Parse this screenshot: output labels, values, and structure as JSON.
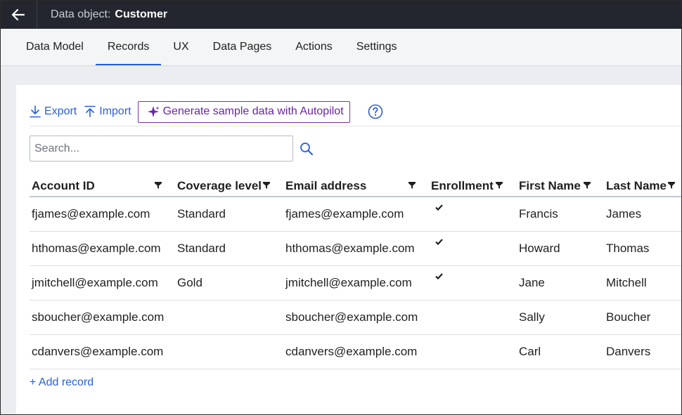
{
  "header": {
    "back_icon": "arrow-left-icon",
    "title_prefix": "Data object:",
    "title_name": "Customer"
  },
  "tabs": [
    {
      "label": "Data Model",
      "active": false
    },
    {
      "label": "Records",
      "active": true
    },
    {
      "label": "UX",
      "active": false
    },
    {
      "label": "Data Pages",
      "active": false
    },
    {
      "label": "Actions",
      "active": false
    },
    {
      "label": "Settings",
      "active": false
    }
  ],
  "toolbar": {
    "export_label": "Export",
    "import_label": "Import",
    "autopilot_label": "Generate sample data with Autopilot",
    "help_icon": "question-circle-icon"
  },
  "search": {
    "placeholder": "Search...",
    "value": ""
  },
  "table": {
    "columns": [
      "Account ID",
      "Coverage level",
      "Email address",
      "Enrollment",
      "First Name",
      "Last Name"
    ],
    "rows": [
      {
        "account_id": "fjames@example.com",
        "coverage": "Standard",
        "email": "fjames@example.com",
        "enrolled": true,
        "first": "Francis",
        "last": "James"
      },
      {
        "account_id": "hthomas@example.com",
        "coverage": "Standard",
        "email": "hthomas@example.com",
        "enrolled": true,
        "first": "Howard",
        "last": "Thomas"
      },
      {
        "account_id": "jmitchell@example.com",
        "coverage": "Gold",
        "email": "jmitchell@example.com",
        "enrolled": true,
        "first": "Jane",
        "last": "Mitchell"
      },
      {
        "account_id": "sboucher@example.com",
        "coverage": "",
        "email": "sboucher@example.com",
        "enrolled": false,
        "first": "Sally",
        "last": "Boucher"
      },
      {
        "account_id": "cdanvers@example.com",
        "coverage": "",
        "email": "cdanvers@example.com",
        "enrolled": false,
        "first": "Carl",
        "last": "Danvers"
      }
    ]
  },
  "add_record_label": "+ Add record",
  "colors": {
    "header_bg": "#23262e",
    "accent_blue": "#2a5fd9",
    "autopilot_purple": "#6b23a8"
  }
}
